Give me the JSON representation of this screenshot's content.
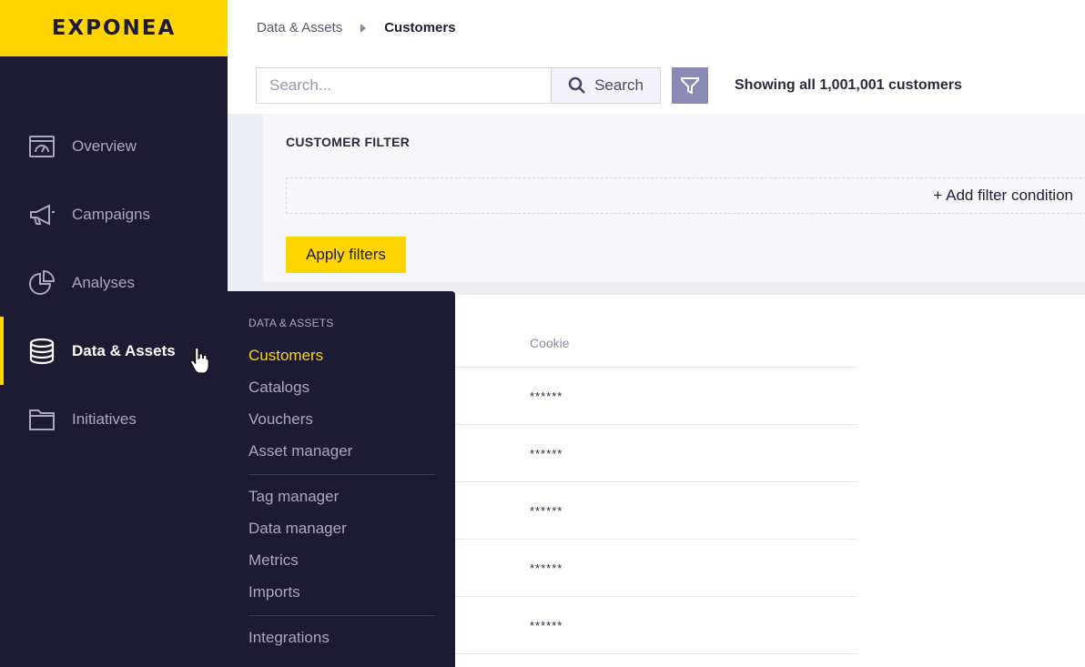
{
  "brand": {
    "logo_text": "EXPONEA",
    "accent": "#ffd500",
    "sidebar_bg": "#1d1a33"
  },
  "sidebar": {
    "items": [
      {
        "label": "Overview",
        "icon": "dashboard-icon"
      },
      {
        "label": "Campaigns",
        "icon": "megaphone-icon"
      },
      {
        "label": "Analyses",
        "icon": "pie-chart-icon"
      },
      {
        "label": "Data & Assets",
        "icon": "database-icon",
        "active": true
      },
      {
        "label": "Initiatives",
        "icon": "folder-icon"
      }
    ]
  },
  "breadcrumb": {
    "parent": "Data & Assets",
    "current": "Customers"
  },
  "search": {
    "placeholder": "Search...",
    "value": "",
    "button_label": "Search"
  },
  "summary": {
    "text": "Showing all 1,001,001 customers"
  },
  "customer_filter": {
    "title": "CUSTOMER FILTER",
    "add_condition_label": "+ Add filter condition",
    "apply_label": "Apply filters"
  },
  "table": {
    "columns": [
      "Cookie"
    ],
    "rows": [
      {
        "cookie": "******"
      },
      {
        "cookie": "******"
      },
      {
        "cookie": "******"
      },
      {
        "cookie": "******"
      },
      {
        "cookie": "******"
      }
    ]
  },
  "flyout": {
    "heading": "DATA & ASSETS",
    "groups": [
      [
        {
          "label": "Customers",
          "active": true
        },
        {
          "label": "Catalogs"
        },
        {
          "label": "Vouchers"
        },
        {
          "label": "Asset manager"
        }
      ],
      [
        {
          "label": "Tag manager"
        },
        {
          "label": "Data manager"
        },
        {
          "label": "Metrics"
        },
        {
          "label": "Imports"
        }
      ],
      [
        {
          "label": "Integrations"
        }
      ]
    ]
  }
}
